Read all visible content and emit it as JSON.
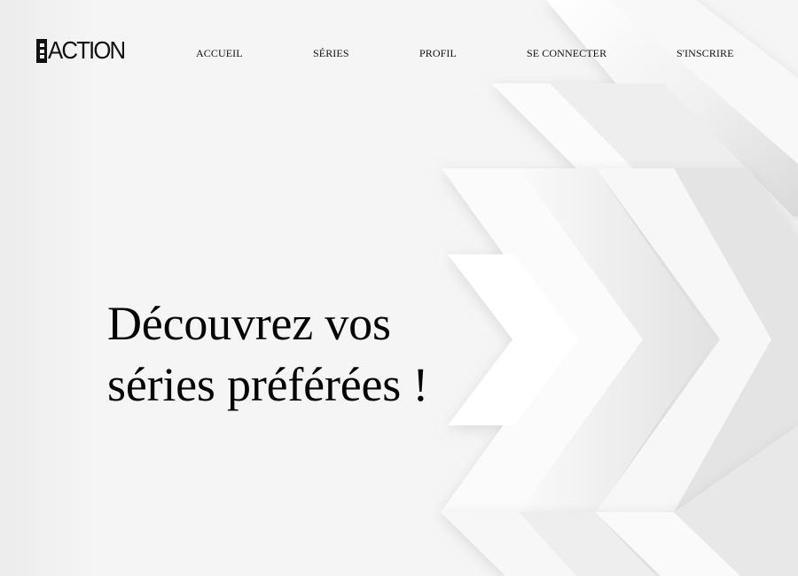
{
  "brand": {
    "name": "ACTION",
    "icon": "book-logo-icon"
  },
  "navigation": {
    "items": [
      {
        "label": "ACCUEIL"
      },
      {
        "label": "SÉRIES"
      },
      {
        "label": "PROFIL"
      },
      {
        "label": "SE CONNECTER"
      },
      {
        "label": "S'INSCRIRE"
      }
    ]
  },
  "hero": {
    "title_lines": [
      "Découvrez vos",
      "séries préférées !"
    ]
  },
  "colors": {
    "background": "#f4f4f4",
    "text": "#111111",
    "pattern_light": "#fbfbfb",
    "pattern_shadow": "#d8d8d8"
  }
}
